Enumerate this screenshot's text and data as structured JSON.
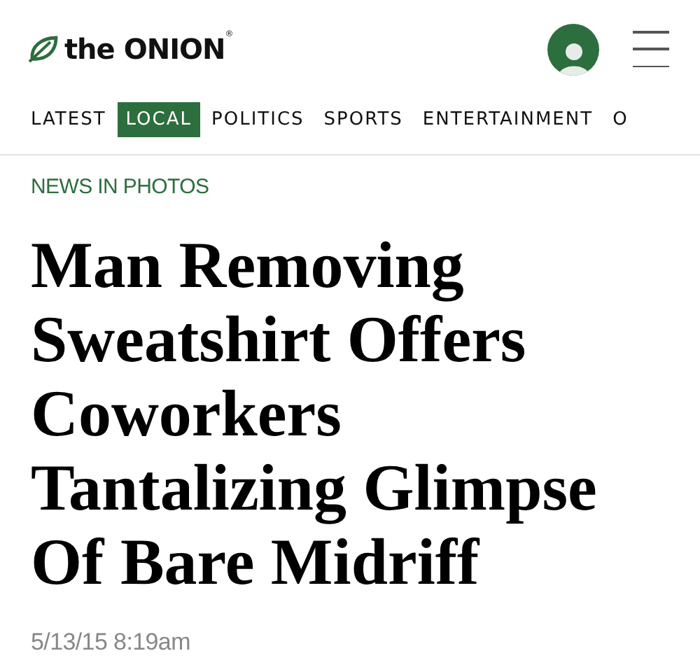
{
  "header": {
    "logo": "the ONION$^{®}$"
  },
  "nav": [
    {
      "label": "LATEST",
      "selected": false
    },
    {
      "label": "LOCAL",
      "selected": true
    },
    {
      "label": "POLITICS",
      "selected": false
    },
    {
      "label": "SPORTS",
      "selected": false
    },
    {
      "label": "ENTERTAINMENT",
      "selected": false
    },
    {
      "label": "O",
      "selected": false
    }
  ],
  "article": {
    "kicker": "NEWS IN PHOTOS",
    "headline": "Man Removing Sweatshirt Offers Coworkers Tantalizing Glimpse Of Bare Midriff",
    "date": "5/13/15 8:19am"
  }
}
